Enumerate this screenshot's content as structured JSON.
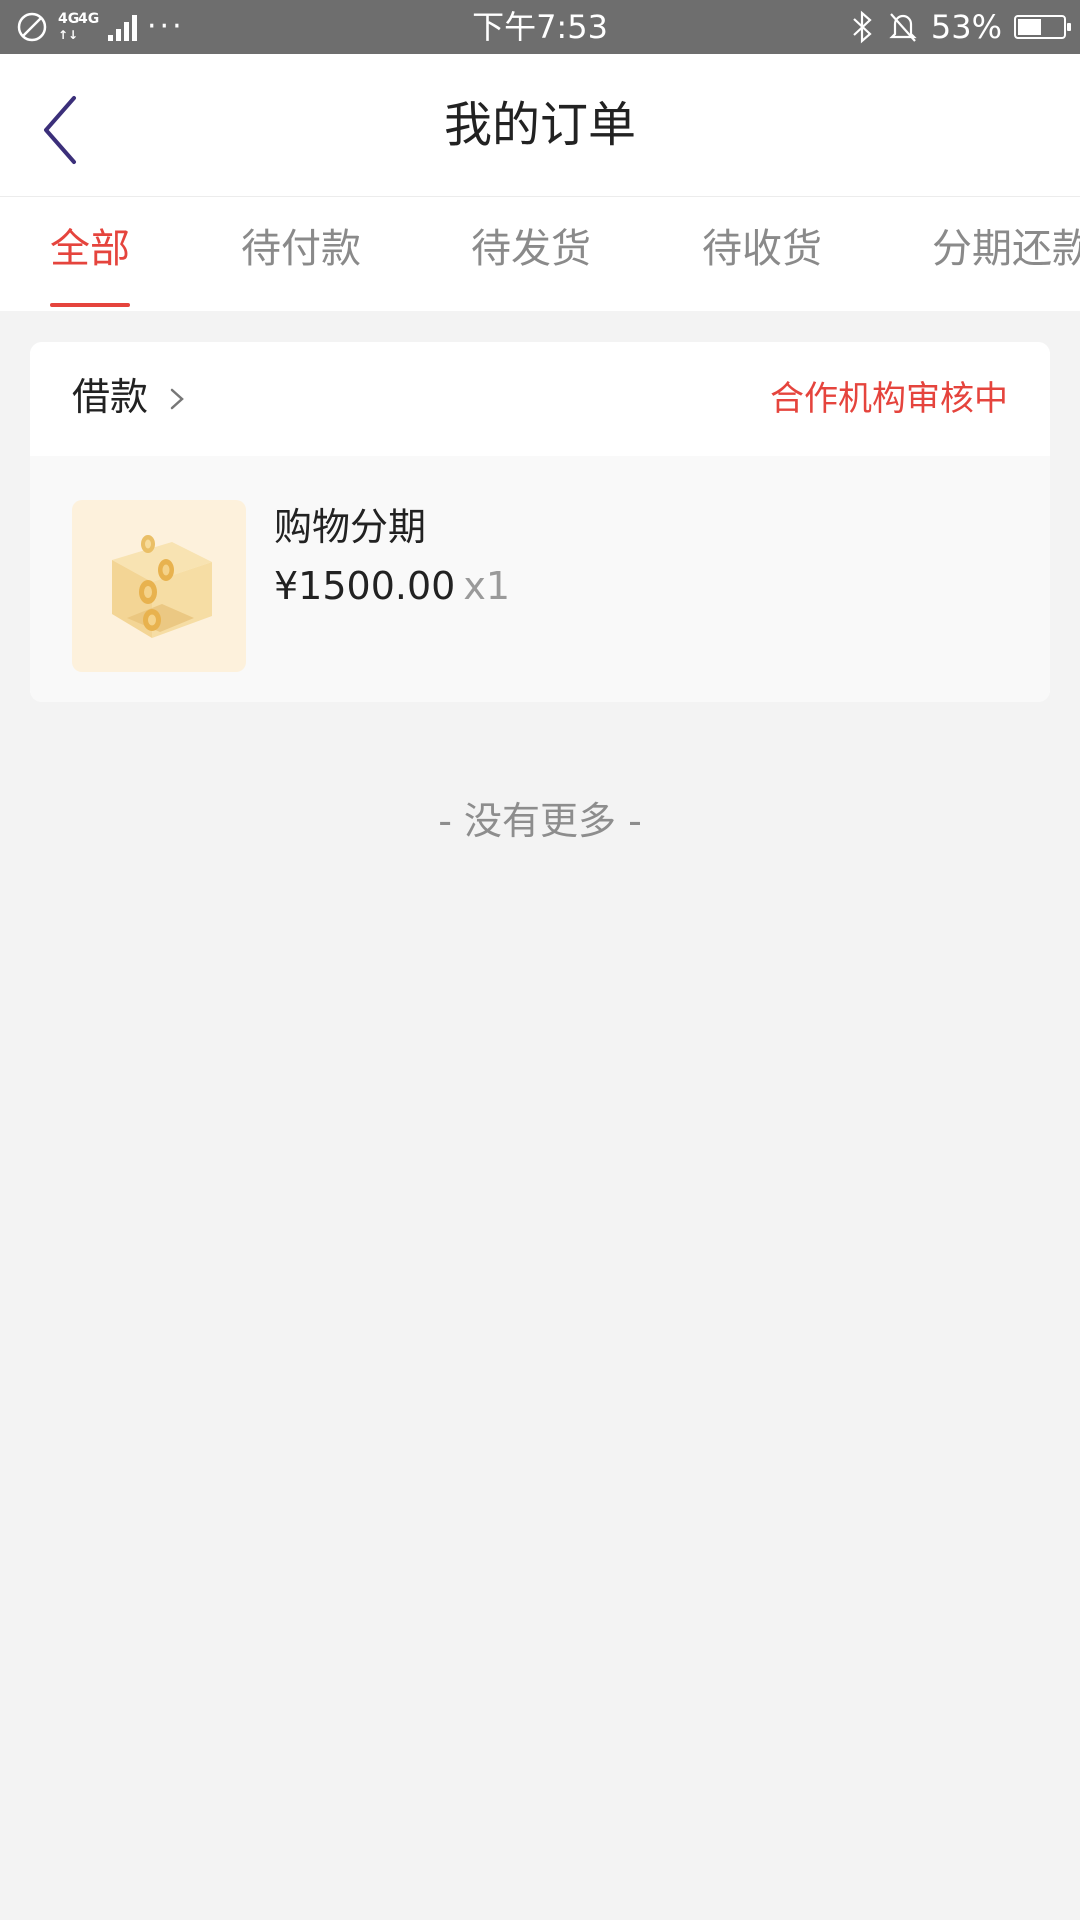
{
  "status_bar": {
    "network": "4G",
    "network2": "4G",
    "more": "···",
    "time": "下午7:53",
    "battery": "53%",
    "battery_level": 0.53
  },
  "header": {
    "title": "我的订单"
  },
  "tabs": [
    {
      "label": "全部",
      "active": true
    },
    {
      "label": "待付款",
      "active": false
    },
    {
      "label": "待发货",
      "active": false
    },
    {
      "label": "待收货",
      "active": false
    },
    {
      "label": "分期还款",
      "active": false
    }
  ],
  "order": {
    "type": "借款",
    "status": "合作机构审核中",
    "item_name": "购物分期",
    "price": "¥1500.00",
    "quantity": "x1"
  },
  "footer": {
    "no_more": "- 没有更多 -"
  },
  "colors": {
    "accent": "#e5443d",
    "back_icon": "#3b2f7a"
  }
}
